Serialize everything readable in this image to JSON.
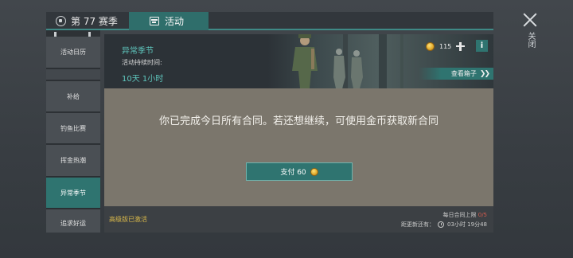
{
  "tabs": {
    "season": "第 77 赛季",
    "activity": "活动"
  },
  "close": {
    "label": "关闭"
  },
  "sidebar": {
    "items": [
      {
        "label": "活动日历"
      },
      {
        "label": ""
      },
      {
        "label": "补给"
      },
      {
        "label": "钓鱼比赛"
      },
      {
        "label": "挥金热潮"
      },
      {
        "label": "异常季节",
        "active": true
      },
      {
        "label": "追求好运"
      }
    ]
  },
  "banner": {
    "title": "异常季节",
    "duration_label": "活动持续时间:",
    "duration_value": "10天 1小时",
    "coins": "115",
    "info": "i",
    "view_box": "查看箱子"
  },
  "content": {
    "message": "你已完成今日所有合同。若还想继续，可使用金币获取新合同",
    "pay_label": "支付 60"
  },
  "footer": {
    "premium": "高级版已激活",
    "daily_limit_label": "每日合同上限",
    "daily_limit_value": "0/5",
    "refresh_label": "距更新还有：",
    "refresh_time": "03小时 19分48"
  },
  "colors": {
    "accent": "#2f7470",
    "accent_text": "#5fc7be",
    "gold": "#d9b84a",
    "limit_red": "#d25a4d",
    "content_bg": "#7b766c"
  },
  "icons": [
    "shield-icon",
    "calendar-icon",
    "close-icon",
    "coin-icon",
    "plus-icon",
    "info-icon",
    "chevron-right-icon",
    "clock-icon"
  ]
}
